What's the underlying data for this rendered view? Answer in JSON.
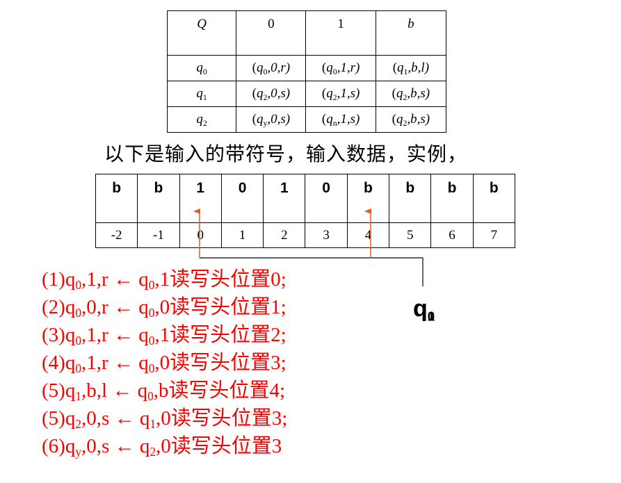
{
  "transition_table": {
    "header": [
      "Q",
      "0",
      "1",
      "b"
    ],
    "rows": [
      {
        "state": "q",
        "state_sub": "0",
        "cells": [
          {
            "s": "q",
            "sub": "0",
            "rest": ",0,r)"
          },
          {
            "s": "q",
            "sub": "0",
            "rest": ",1,r)"
          },
          {
            "s": "q",
            "sub": "1",
            "rest": ",b,l)"
          }
        ]
      },
      {
        "state": "q",
        "state_sub": "1",
        "cells": [
          {
            "s": "q",
            "sub": "2",
            "rest": ",0,s)"
          },
          {
            "s": "q",
            "sub": "2",
            "rest": ",1,s)"
          },
          {
            "s": "q",
            "sub": "2",
            "rest": ",b,s)"
          }
        ]
      },
      {
        "state": "q",
        "state_sub": "2",
        "cells": [
          {
            "s": "q",
            "sub": "y",
            "rest": ",0,s)"
          },
          {
            "s": "q",
            "sub": "n",
            "rest": ",1,s)"
          },
          {
            "s": "q",
            "sub": "2",
            "rest": ",b,s)"
          }
        ]
      }
    ]
  },
  "caption": "以下是输入的带符号，输入数据，实例，",
  "tape": {
    "symbols": [
      "b",
      "b",
      "1",
      "0",
      "1",
      "0",
      "b",
      "b",
      "b",
      "b"
    ],
    "indices": [
      "-2",
      "-1",
      "0",
      "1",
      "2",
      "3",
      "4",
      "5",
      "6",
      "7"
    ]
  },
  "head_label": {
    "letter": "q",
    "overlapped_subs": [
      "0",
      "1"
    ]
  },
  "colors": {
    "steps": "#ff0000",
    "arrow": "#e85a1c",
    "line": "#000000"
  },
  "steps": [
    {
      "n": "(1)q",
      "a": "0",
      "b": ",1,r ← q",
      "c": "0",
      "d": ",1读写头位置0;"
    },
    {
      "n": "(2)q",
      "a": "0",
      "b": ",0,r ← q",
      "c": "0",
      "d": ",0读写头位置1;"
    },
    {
      "n": "(3)q",
      "a": "0",
      "b": ",1,r ← q",
      "c": "0",
      "d": ",1读写头位置2;"
    },
    {
      "n": "(4)q",
      "a": "0",
      "b": ",1,r ← q",
      "c": "0",
      "d": ",0读写头位置3;"
    },
    {
      "n": "(5)q",
      "a": "1",
      "b": ",b,l ← q",
      "c": "0",
      "d": ",b读写头位置4;"
    },
    {
      "n": "(5)q",
      "a": "2",
      "b": ",0,s ← q",
      "c": "1",
      "d": ",0读写头位置3;"
    },
    {
      "n": "(6)q",
      "a": "y",
      "b": ",0,s ← q",
      "c": "2",
      "d": ",0读写头位置3"
    }
  ]
}
